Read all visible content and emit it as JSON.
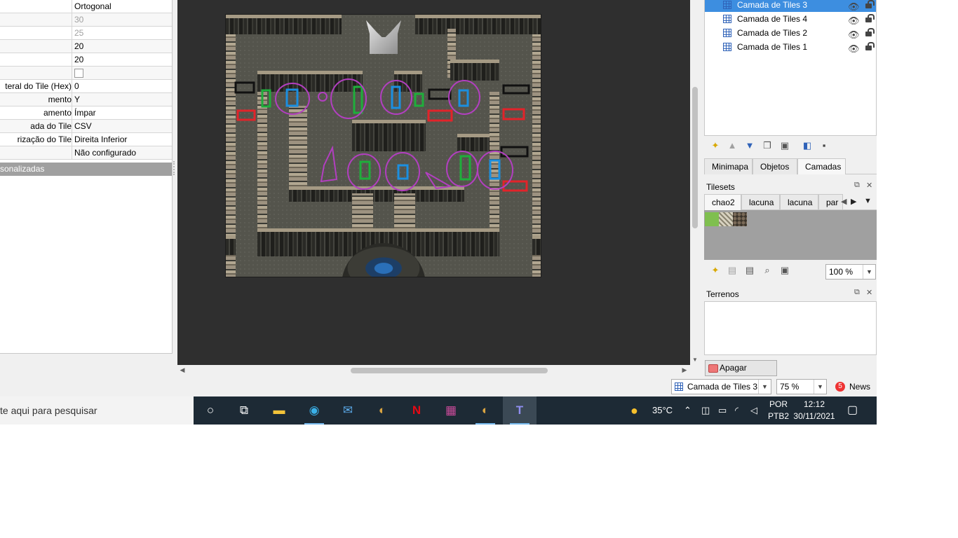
{
  "properties": {
    "rows": [
      {
        "name": "",
        "value": "Ortogonal",
        "dim": false
      },
      {
        "name": "",
        "value": "30",
        "dim": true
      },
      {
        "name": "",
        "value": "25",
        "dim": true
      },
      {
        "name": "",
        "value": "20",
        "dim": false
      },
      {
        "name": "",
        "value": "20",
        "dim": false
      },
      {
        "name": "",
        "value": "",
        "checkbox": true
      },
      {
        "name": "teral do Tile (Hex)",
        "value": "0",
        "dim": false
      },
      {
        "name": "mento",
        "value": "Y",
        "dim": false
      },
      {
        "name": "amento",
        "value": "Ímpar",
        "dim": false
      },
      {
        "name": "ada do Tile",
        "value": "CSV",
        "dim": false
      },
      {
        "name": "rização do Tile",
        "value": "Direita Inferior",
        "dim": false
      },
      {
        "name": "",
        "value": "Não configurado",
        "dim": false
      }
    ],
    "custom_header": "sonalizadas"
  },
  "layers": {
    "items": [
      {
        "label": "Camada de Tiles 3",
        "selected": true
      },
      {
        "label": "Camada de Tiles 4",
        "selected": false
      },
      {
        "label": "Camada de Tiles 2",
        "selected": false
      },
      {
        "label": "Camada de Tiles 1",
        "selected": false
      }
    ]
  },
  "dock_tabs": [
    "Minimapa",
    "Objetos",
    "Camadas"
  ],
  "tilesets": {
    "title": "Tilesets",
    "tabs": [
      "chao2",
      "lacuna",
      "lacuna",
      "par"
    ],
    "zoom": "100 %"
  },
  "terrains": {
    "title": "Terrenos",
    "erase_label": "Apagar Terreno"
  },
  "statusbar": {
    "layer_select": "Camada de Tiles 3",
    "zoom": "75 %",
    "news_count": "5",
    "news_label": "News"
  },
  "taskbar": {
    "search_text": "te aqui para pesquisar",
    "temperature": "35°C",
    "lang_line1": "POR",
    "lang_line2": "PTB2",
    "time": "12:12",
    "date": "30/11/2021"
  },
  "colors": {
    "accent": "#3d8ee0",
    "taskbar": "#1d2a35",
    "canvas": "#2f2f2f"
  }
}
